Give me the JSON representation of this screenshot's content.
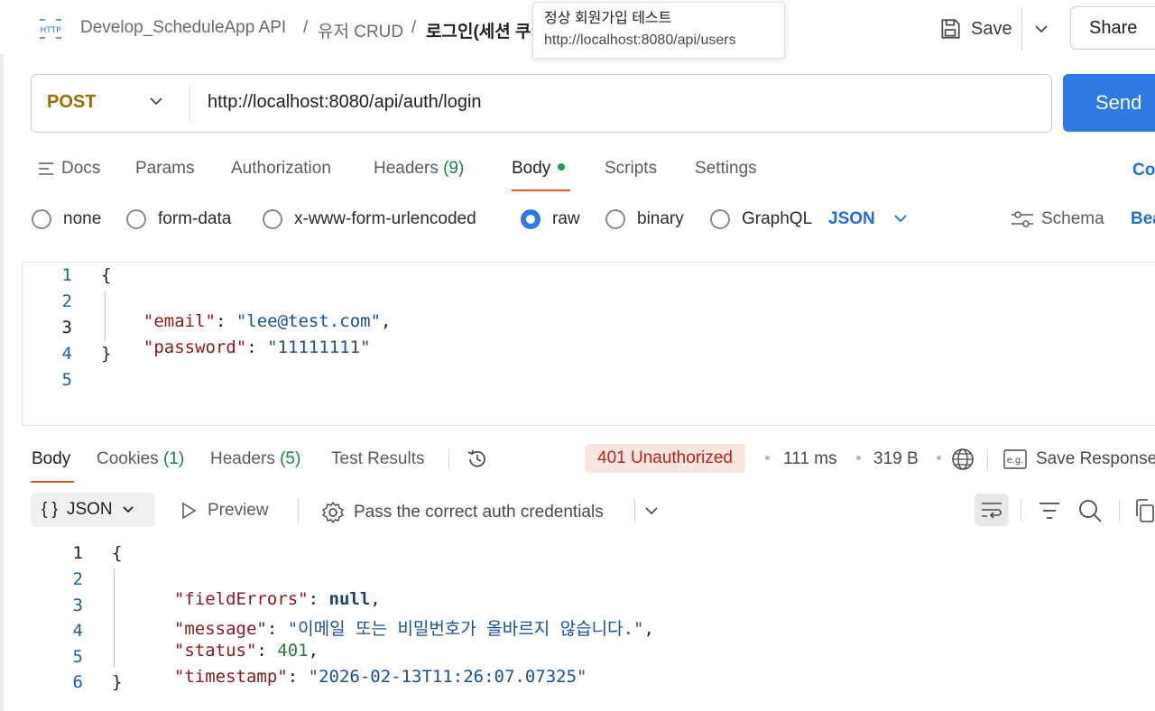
{
  "header": {
    "http_icon_label": "HTTP",
    "breadcrumb": [
      "Develop_ScheduleApp API",
      "/",
      "유저 CRUD",
      "/",
      "로그인(세션 쿠키"
    ],
    "save_label": "Save",
    "share_label": "Share"
  },
  "tooltip": {
    "title": "정상 회원가입 테스트",
    "url": "http://localhost:8080/api/users"
  },
  "request": {
    "method": "POST",
    "url": "http://localhost:8080/api/auth/login",
    "send_label": "Send",
    "tabs": {
      "docs": "Docs",
      "params": "Params",
      "authorization": "Authorization",
      "headers": "Headers",
      "headers_count": "(9)",
      "body": "Body",
      "scripts": "Scripts",
      "settings": "Settings",
      "cookies": "Co"
    },
    "body_types": {
      "none": "none",
      "form_data": "form-data",
      "urlencoded": "x-www-form-urlencoded",
      "raw": "raw",
      "binary": "binary",
      "graphql": "GraphQL",
      "selected": "raw"
    },
    "format": "JSON",
    "schema_label": "Schema",
    "beautify_label": "Bea",
    "line_numbers": [
      "1",
      "2",
      "3",
      "4",
      "5"
    ],
    "body_code": {
      "open": "{",
      "email_key": "\"email\"",
      "email_val": "\"lee@test.com\"",
      "password_key": "\"password\"",
      "password_val": "\"11111111\"",
      "close": "}"
    }
  },
  "response": {
    "tabs": {
      "body": "Body",
      "cookies": "Cookies",
      "cookies_count": "(1)",
      "headers": "Headers",
      "headers_count": "(5)",
      "test_results": "Test Results"
    },
    "status": "401 Unauthorized",
    "time": "111 ms",
    "size": "319 B",
    "save_response_label": "Save Response",
    "format_label": "JSON",
    "format_icon": "{ }",
    "preview_label": "Preview",
    "auth_hint": "Pass the correct auth credentials",
    "line_numbers": [
      "1",
      "2",
      "3",
      "4",
      "5",
      "6"
    ],
    "body_code": {
      "open": "{",
      "field_errors_key": "\"fieldErrors\"",
      "field_errors_val": "null",
      "message_key": "\"message\"",
      "message_val": "\"이메일 또는 비밀번호가 올바르지 않습니다.\"",
      "status_key": "\"status\"",
      "status_val": "401",
      "timestamp_key": "\"timestamp\"",
      "timestamp_val": "\"2026-02-13T11:26:07.07325\"",
      "close": "}"
    }
  },
  "colors": {
    "accent_blue": "#2f7ae5",
    "active_tab_underline": "#e4572e",
    "method_post": "#9a6a00",
    "status_error_bg": "#fbe5e1",
    "status_error_fg": "#b3261e"
  }
}
